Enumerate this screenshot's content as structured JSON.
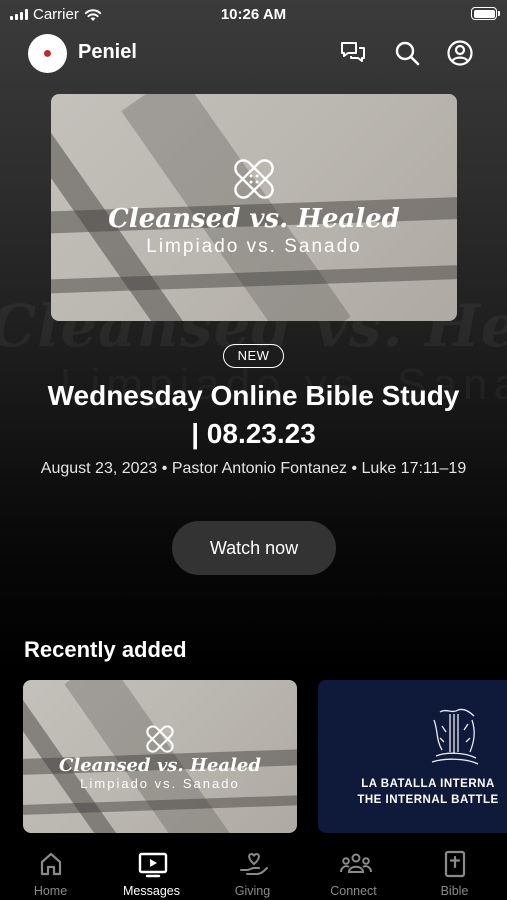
{
  "status_bar": {
    "carrier": "Carrier",
    "time": "10:26 AM"
  },
  "header": {
    "app_name": "Peniel",
    "icons": [
      "chat-icon",
      "search-icon",
      "profile-icon"
    ]
  },
  "hero": {
    "thumbnail": {
      "title": "Cleansed vs. Healed",
      "subtitle": "Limpiado vs. Sanado"
    },
    "badge": "NEW",
    "title": "Wednesday Online Bible Study | 08.23.23",
    "meta": "August 23, 2023 • Pastor Antonio Fontanez • Luke 17:11–19",
    "watch_label": "Watch now"
  },
  "recently_added": {
    "title": "Recently added",
    "cards": [
      {
        "title": "Cleansed vs. Healed",
        "subtitle": "Limpiado vs. Sanado"
      },
      {
        "line1": "LA BATALLA INTERNA",
        "line2": "THE INTERNAL BATTLE"
      }
    ]
  },
  "tabs": [
    {
      "label": "Home",
      "icon": "home-icon",
      "active": false
    },
    {
      "label": "Messages",
      "icon": "tv-play-icon",
      "active": true
    },
    {
      "label": "Giving",
      "icon": "giving-hand-icon",
      "active": false
    },
    {
      "label": "Connect",
      "icon": "people-icon",
      "active": false
    },
    {
      "label": "Bible",
      "icon": "bible-icon",
      "active": false
    }
  ],
  "colors": {
    "background": "#000000",
    "button": "#333333",
    "logo_accent": "#c2262e",
    "card_navy": "#0f1a3a"
  }
}
